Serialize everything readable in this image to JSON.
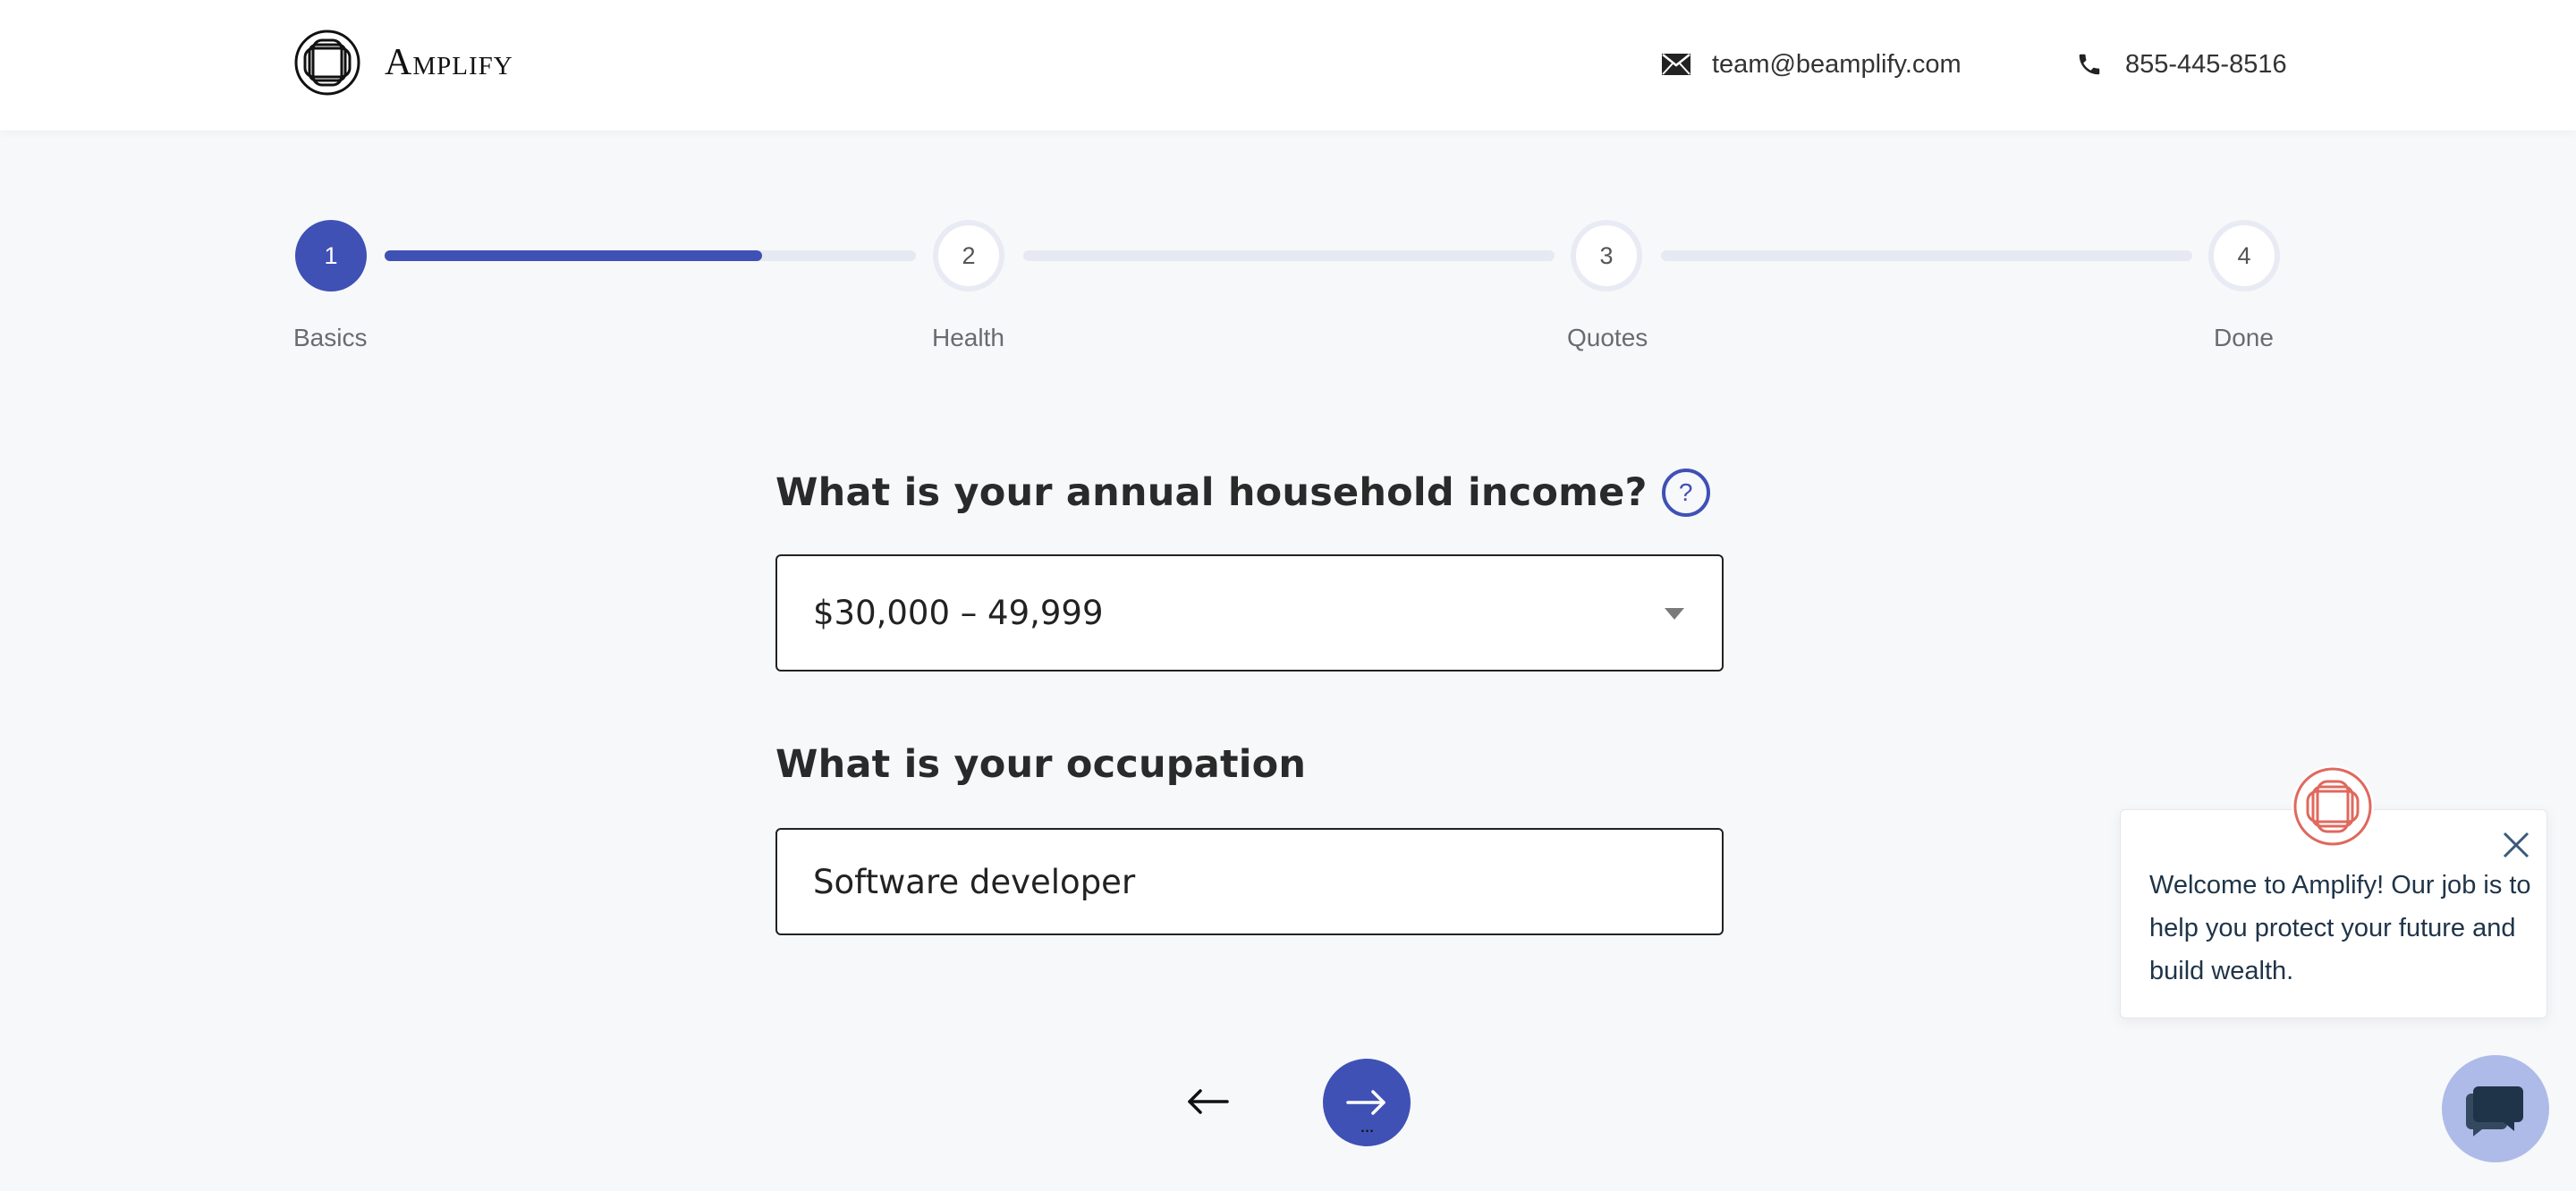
{
  "header": {
    "logo_text": "Amplify",
    "email": "team@beamplify.com",
    "phone": "855-445-8516",
    "icons": {
      "email": "envelope-icon",
      "phone": "phone-icon"
    }
  },
  "stepper": {
    "steps": [
      {
        "number": "1",
        "label": "Basics",
        "state": "active"
      },
      {
        "number": "2",
        "label": "Health",
        "state": "inactive"
      },
      {
        "number": "3",
        "label": "Quotes",
        "state": "inactive"
      },
      {
        "number": "4",
        "label": "Done",
        "state": "inactive"
      }
    ],
    "segment_progress": [
      0.71,
      0,
      0
    ]
  },
  "form": {
    "income_question": "What is your annual household income?",
    "income_help": "?",
    "income_selected": "$30,000 – 49,999",
    "occupation_question": "What is your occupation",
    "occupation_value": "Software developer"
  },
  "nav": {
    "back_icon": "arrow-left-icon",
    "next_icon": "arrow-right-icon",
    "next_dots": "..."
  },
  "chat": {
    "message": "Welcome to Amplify! Our job is to help you protect your future and build wealth.",
    "close_icon": "close-icon",
    "launcher_icon": "chat-bubbles-icon"
  },
  "colors": {
    "accent": "#3f51b5",
    "track": "#e6e9f1",
    "chat_logo": "#e0685e",
    "launcher_bg": "#aebbe8"
  }
}
